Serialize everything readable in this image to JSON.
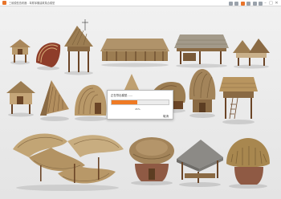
{
  "window": {
    "title": "三维模型查看器 - 草屋茅棚建筑集合模型",
    "minimize": "–",
    "maximize": "□",
    "close": "✕"
  },
  "loading_dialog": {
    "title": "正在导出模型……",
    "progress_value": 0.45,
    "percent_text": "45%",
    "cancel_label": "取消"
  },
  "colors": {
    "accent": "#ef7a24",
    "thatch": "#a9875a",
    "wood": "#7a5230"
  }
}
